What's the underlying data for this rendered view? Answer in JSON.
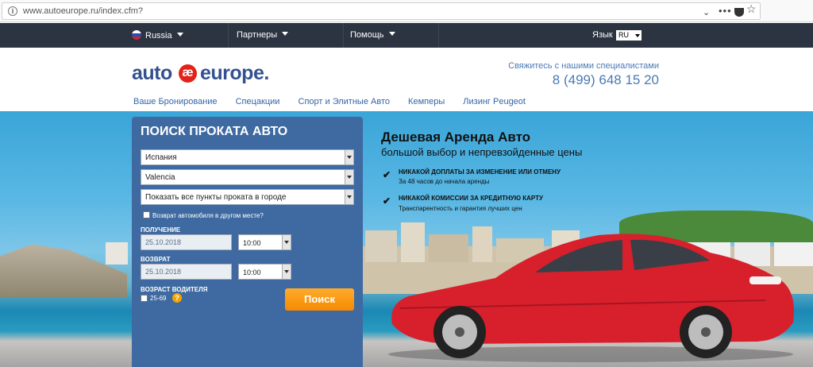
{
  "browser": {
    "url": "www.autoeurope.ru/index.cfm?",
    "menu_dots": "•••"
  },
  "topnav": {
    "country": "Russia",
    "partners": "Партнеры",
    "help": "Помощь",
    "language_label": "Язык",
    "language_value": "RU"
  },
  "header": {
    "logo_auto": "auto",
    "logo_mark": "æ",
    "logo_europe": "europe.",
    "contact_label": "Свяжитесь с нашими специалистами",
    "phone": "8 (499) 648 15 20",
    "subnav": [
      "Ваше Бронирование",
      "Спецакции",
      "Спорт и Элитные Авто",
      "Кемперы",
      "Лизинг Peugeot"
    ]
  },
  "search": {
    "title": "ПОИСК ПРОКАТА АВТО",
    "country": "Испания",
    "city": "Valencia",
    "location": "Показать все пункты проката в городе",
    "return_other": "Возврат автомобиля в другом месте?",
    "pickup_label": "ПОЛУЧЕНИЕ",
    "pickup_date": "25.10.2018",
    "pickup_time": "10:00",
    "return_label": "ВОЗВРАТ",
    "return_date": "25.10.2018",
    "return_time": "10:00",
    "age_label": "ВОЗРАСТ ВОДИТЕЛЯ",
    "age_value": "25-69",
    "help_symbol": "?",
    "button": "Поиск"
  },
  "promo": {
    "title": "Дешевая Аренда Авто",
    "subtitle": "большой выбор и непревзойденные цены",
    "check": "✔",
    "features": [
      {
        "title": "НИКАКОЙ ДОПЛАТЫ ЗА ИЗМЕНЕНИЕ ИЛИ ОТМЕНУ",
        "sub": "За 48 часов до начала аренды"
      },
      {
        "title": "НИКАКОЙ КОМИССИИ ЗА КРЕДИТНУЮ КАРТУ",
        "sub": "Транспарентность и гарантия лучших цен"
      }
    ]
  },
  "colors": {
    "nav_bg": "#2b3440",
    "brand_blue": "#33518f",
    "panel_blue": "#3e6aa1",
    "accent_orange": "#f58a00",
    "car_red": "#d8202c"
  }
}
